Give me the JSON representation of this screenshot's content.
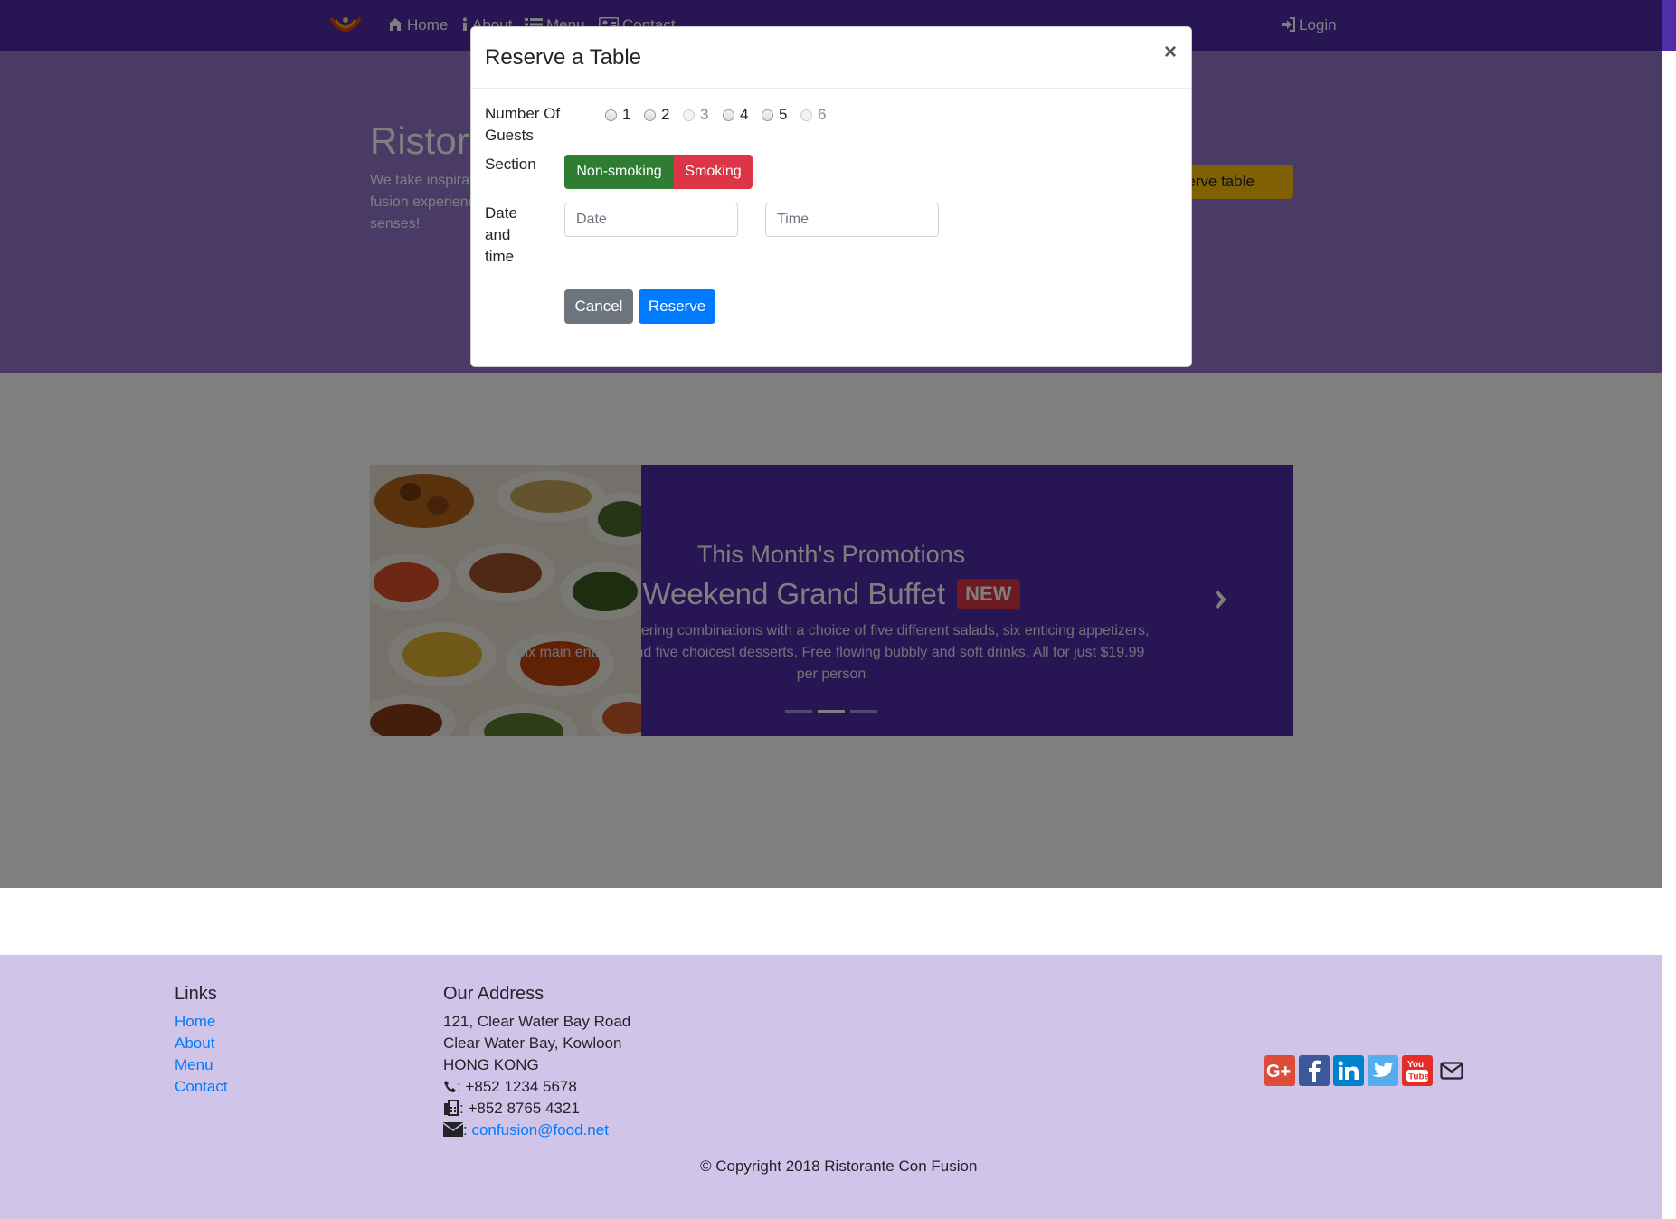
{
  "nav": {
    "home": "Home",
    "about": "About",
    "menu": "Menu",
    "contact": "Contact",
    "login": "Login"
  },
  "jumbotron": {
    "title": "Ristorante Con Fusion",
    "text": "We take inspiration from the World's best cuisines, and create a unique fusion experience. Our lipsmacking creations will tickle your culinary senses!",
    "reserve_button": "Reserve table"
  },
  "carousel": {
    "subtitle": "This Month's Promotions",
    "title": "Weekend Grand Buffet",
    "badge": "NEW",
    "description": "Featuring mouthwatering combinations with a choice of five different salads, six enticing appetizers, six main entrees and five choicest desserts. Free flowing bubbly and soft drinks. All for just $19.99 per person",
    "active_slide": 2
  },
  "modal": {
    "title": "Reserve a Table",
    "close": "×",
    "guests_label": "Number Of Guests",
    "guest_options": [
      "1",
      "2",
      "3",
      "4",
      "5",
      "6"
    ],
    "section_label": "Section",
    "non_smoking": "Non-smoking",
    "smoking": "Smoking",
    "datetime_label": "Date and time",
    "date_placeholder": "Date",
    "time_placeholder": "Time",
    "cancel": "Cancel",
    "reserve": "Reserve"
  },
  "footer": {
    "links_heading": "Links",
    "links": [
      "Home",
      "About",
      "Menu",
      "Contact"
    ],
    "address_heading": "Our Address",
    "address_lines": [
      "121, Clear Water Bay Road",
      "Clear Water Bay, Kowloon",
      "HONG KONG"
    ],
    "phone": ": +852 1234 5678",
    "fax": ": +852 8765 4321",
    "email_prefix": ": ",
    "email": "confusion@food.net",
    "copyright": "© Copyright 2018 Ristorante Con Fusion"
  },
  "colors": {
    "navbar": "#512da8",
    "jumbotron": "#9575cd",
    "footer": "#d1c4e9",
    "success": "#28a745",
    "danger": "#dc3545",
    "primary": "#007bff",
    "secondary": "#6c757d",
    "warning": "#ffc107"
  },
  "icons": [
    "home-icon",
    "info-icon",
    "list-icon",
    "address-card-icon",
    "sign-in-icon",
    "phone-icon",
    "fax-icon",
    "envelope-icon",
    "google-plus-icon",
    "facebook-icon",
    "linkedin-icon",
    "twitter-icon",
    "youtube-icon",
    "envelope-o-icon",
    "chevron-right-icon"
  ]
}
